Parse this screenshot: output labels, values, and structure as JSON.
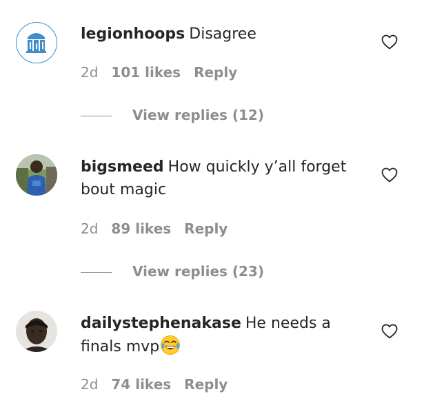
{
  "comments": [
    {
      "username": "legionhoops",
      "text": "Disagree",
      "age": "2d",
      "likes": "101 likes",
      "reply": "Reply",
      "view_replies": "View replies (12)",
      "avatar_icon": "legionhoops-logo-avatar"
    },
    {
      "username": "bigsmeed",
      "text": "How quickly y’all forget bout magic",
      "age": "2d",
      "likes": "89 likes",
      "reply": "Reply",
      "view_replies": "View replies (23)",
      "avatar_icon": "profile-photo-avatar"
    },
    {
      "username": "dailystephenakase",
      "text": "He needs a finals mvp",
      "emoji": "face-with-tears-of-joy-emoji",
      "age": "2d",
      "likes": "74 likes",
      "reply": "Reply",
      "avatar_icon": "profile-photo-avatar"
    }
  ],
  "colors": {
    "text": "#262626",
    "muted": "#8e8e8e",
    "logo_blue": "#3d8ec9"
  }
}
